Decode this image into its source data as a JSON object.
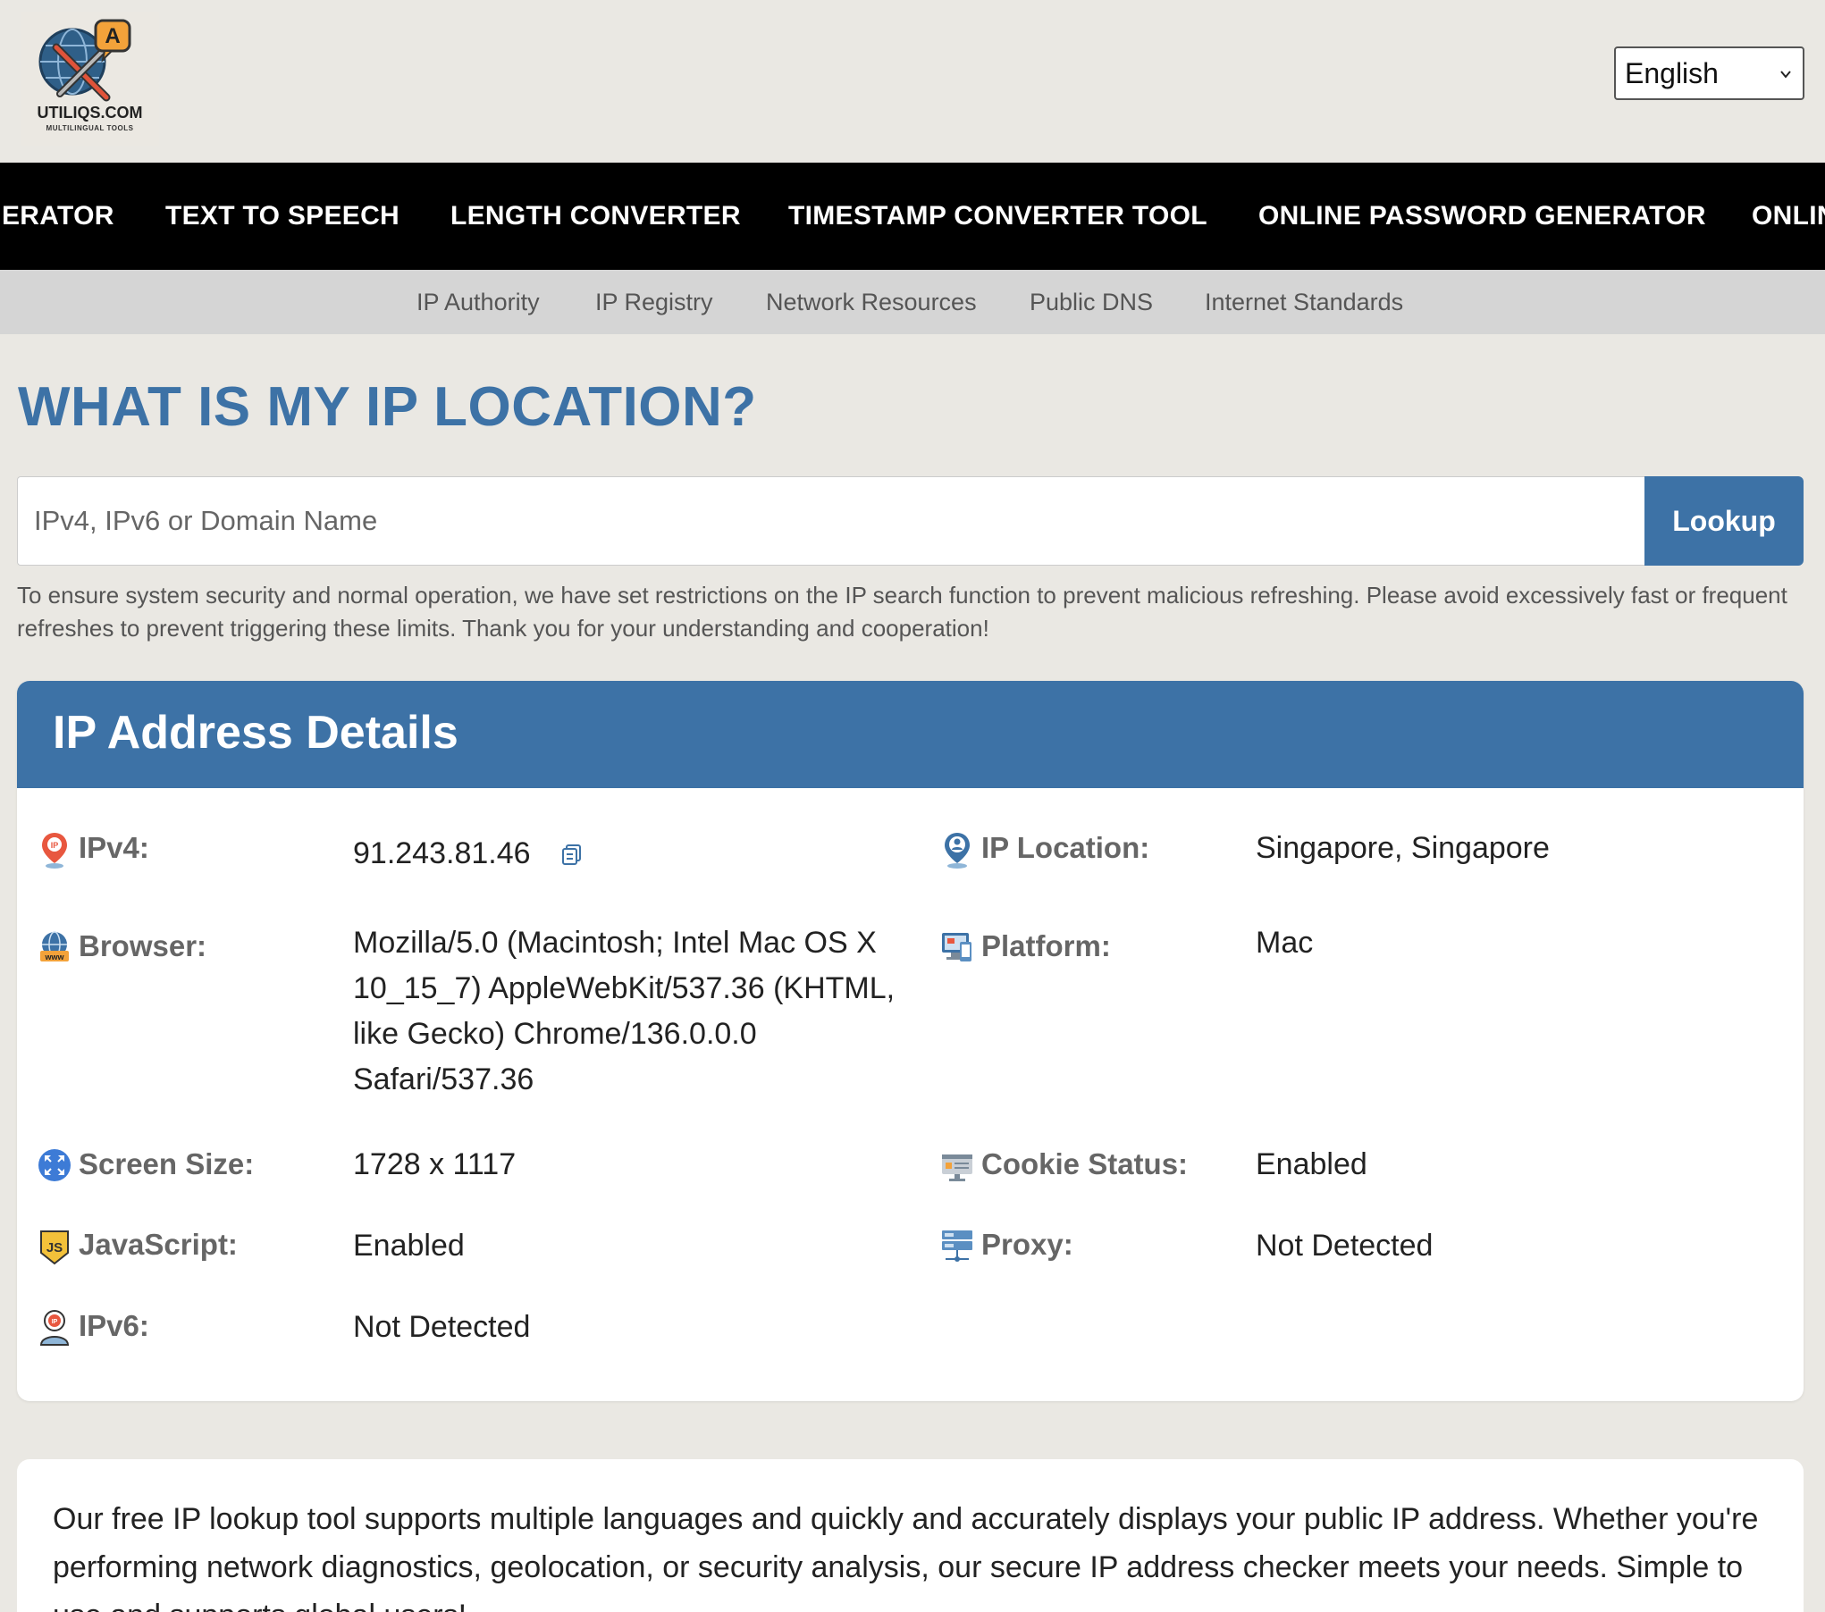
{
  "site": {
    "logo_text": "UTILIQS.COM",
    "logo_subtext": "MULTILINGUAL TOOLS",
    "language_selected": "English"
  },
  "main_nav": [
    {
      "label": "ERATOR"
    },
    {
      "label": "TEXT TO SPEECH"
    },
    {
      "label": "LENGTH CONVERTER"
    },
    {
      "label": "TIMESTAMP CONVERTER TOOL"
    },
    {
      "label": "ONLINE PASSWORD GENERATOR"
    },
    {
      "label": "ONLIN"
    }
  ],
  "sub_nav": [
    {
      "label": "IP Authority"
    },
    {
      "label": "IP Registry"
    },
    {
      "label": "Network Resources"
    },
    {
      "label": "Public DNS"
    },
    {
      "label": "Internet Standards"
    }
  ],
  "page": {
    "title": "WHAT IS MY IP LOCATION?",
    "search_placeholder": "IPv4, IPv6 or Domain Name",
    "lookup_label": "Lookup",
    "notice": "To ensure system security and normal operation, we have set restrictions on the IP search function to prevent malicious refreshing. Please avoid excessively fast or frequent refreshes to prevent triggering these limits. Thank you for your understanding and cooperation!"
  },
  "details": {
    "heading": "IP Address Details",
    "ipv4": {
      "label": "IPv4:",
      "value": "91.243.81.46",
      "icon": "ip-pin-icon"
    },
    "ip_location": {
      "label": "IP Location:",
      "value": "Singapore, Singapore",
      "icon": "location-person-icon"
    },
    "browser": {
      "label": "Browser:",
      "value": "Mozilla/5.0 (Macintosh; Intel Mac OS X 10_15_7) AppleWebKit/537.36 (KHTML, like Gecko) Chrome/136.0.0.0 Safari/537.36",
      "icon": "www-globe-icon"
    },
    "platform": {
      "label": "Platform:",
      "value": "Mac",
      "icon": "devices-icon"
    },
    "screen_size": {
      "label": "Screen Size:",
      "value": "1728 x 1117",
      "icon": "expand-arrows-icon"
    },
    "cookie_status": {
      "label": "Cookie Status:",
      "value": "Enabled",
      "icon": "cookie-settings-icon"
    },
    "javascript": {
      "label": "JavaScript:",
      "value": "Enabled",
      "icon": "js-shield-icon"
    },
    "proxy": {
      "label": "Proxy:",
      "value": "Not Detected",
      "icon": "server-icon"
    },
    "ipv6": {
      "label": "IPv6:",
      "value": "Not Detected",
      "icon": "ip-person-icon"
    }
  },
  "about": {
    "text": "Our free IP lookup tool supports multiple languages and quickly and accurately displays your public IP address. Whether you're performing network diagnostics, geolocation, or security analysis, our secure IP address checker meets your needs. Simple to use and supports global users!"
  },
  "colors": {
    "accent": "#3d72a6",
    "background": "#eae8e3",
    "nav_bg": "#000000",
    "subnav_bg": "#d5d5d5"
  }
}
